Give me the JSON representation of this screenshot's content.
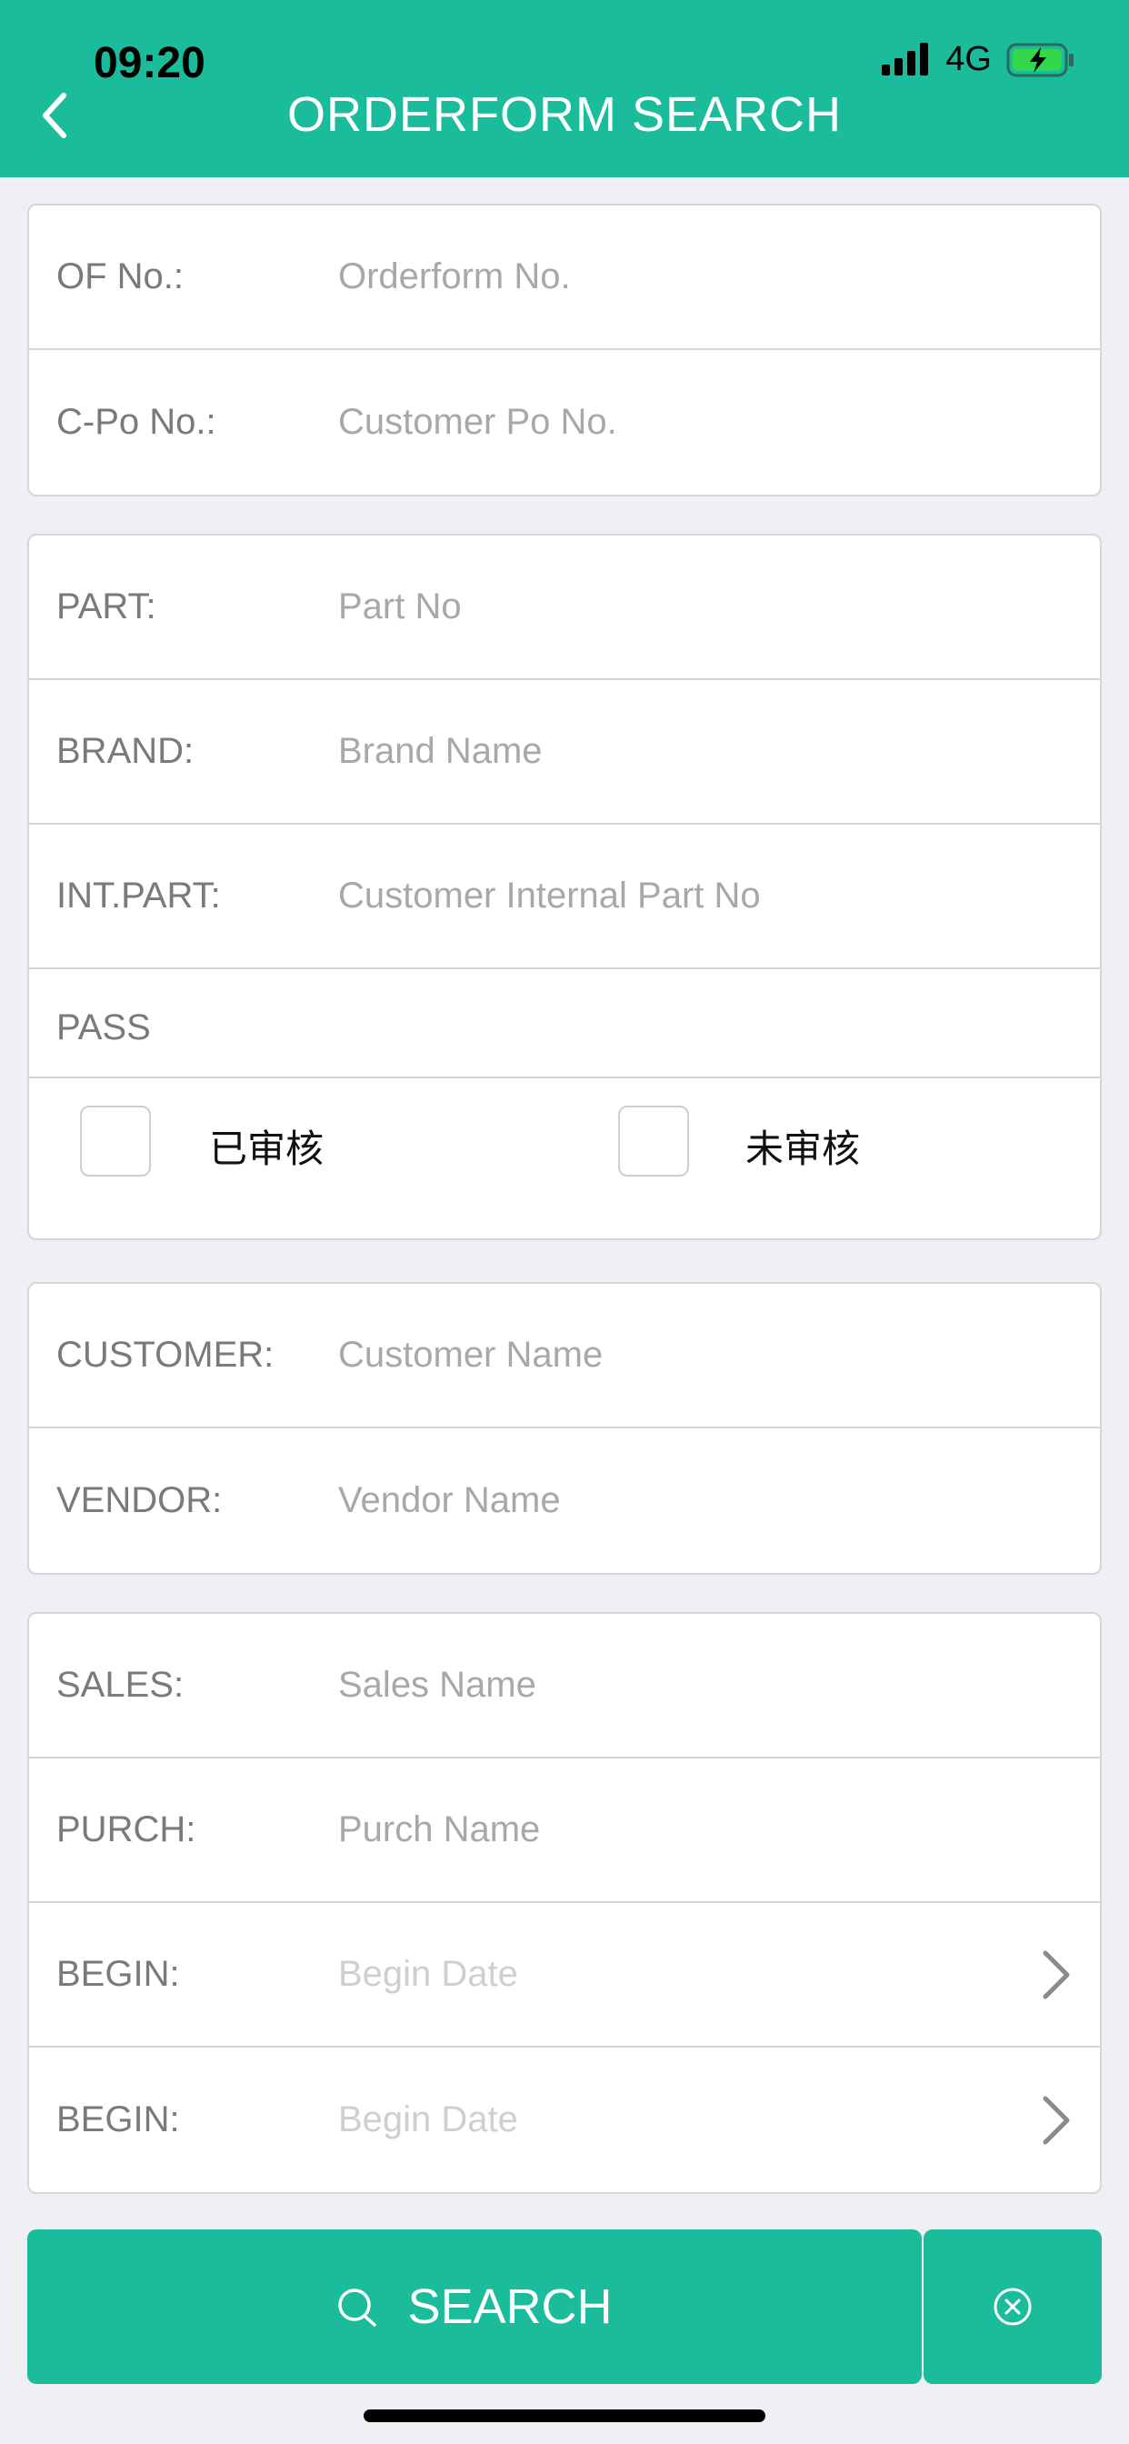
{
  "status": {
    "time": "09:20",
    "network": "4G"
  },
  "header": {
    "title": "ORDERFORM SEARCH"
  },
  "group1": {
    "of_no": {
      "label": "OF No.:",
      "placeholder": "Orderform No.",
      "value": ""
    },
    "cpo_no": {
      "label": "C-Po No.:",
      "placeholder": "Customer Po No.",
      "value": ""
    }
  },
  "group2": {
    "part": {
      "label": "PART:",
      "placeholder": "Part No",
      "value": ""
    },
    "brand": {
      "label": "BRAND:",
      "placeholder": "Brand Name",
      "value": ""
    },
    "int_part": {
      "label": "INT.PART:",
      "placeholder": "Customer Internal Part No",
      "value": ""
    },
    "pass": {
      "label": "PASS",
      "options": [
        {
          "label": "已审核",
          "checked": false
        },
        {
          "label": "未审核",
          "checked": false
        }
      ]
    }
  },
  "group3": {
    "customer": {
      "label": "CUSTOMER:",
      "placeholder": "Customer Name",
      "value": ""
    },
    "vendor": {
      "label": "VENDOR:",
      "placeholder": "Vendor Name",
      "value": ""
    }
  },
  "group4": {
    "sales": {
      "label": "SALES:",
      "placeholder": "Sales Name",
      "value": ""
    },
    "purch": {
      "label": "PURCH:",
      "placeholder": "Purch Name",
      "value": ""
    },
    "begin1": {
      "label": "BEGIN:",
      "placeholder": "Begin Date",
      "value": ""
    },
    "begin2": {
      "label": "BEGIN:",
      "placeholder": "Begin Date",
      "value": ""
    }
  },
  "actions": {
    "search_label": "SEARCH"
  },
  "colors": {
    "accent": "#1bbc9b",
    "background": "#efeff4",
    "border": "#d6d6da"
  },
  "icons": {
    "back": "chevron-left-icon",
    "search": "search-icon",
    "clear": "close-circle-icon",
    "date": "chevron-right-icon"
  }
}
